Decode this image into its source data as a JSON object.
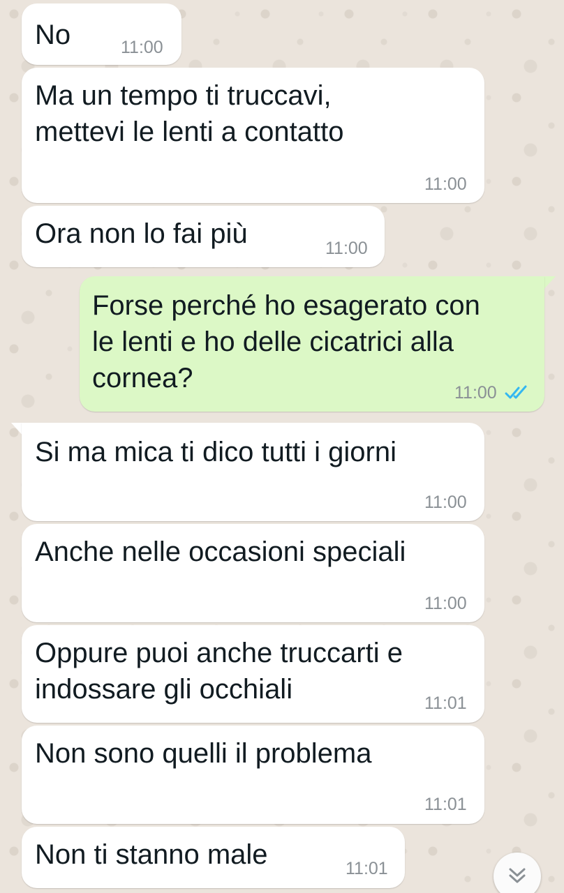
{
  "messages": [
    {
      "direction": "in",
      "text": "No",
      "time": "11:00"
    },
    {
      "direction": "in",
      "text": "Ma un tempo ti truccavi,\nmettevi le lenti a contatto",
      "time": "11:00"
    },
    {
      "direction": "in",
      "text": "Ora non lo fai più",
      "time": "11:00"
    },
    {
      "direction": "out",
      "text": "Forse perché ho esagerato con\nle lenti e ho delle cicatrici alla\ncornea?",
      "time": "11:00",
      "status_icon": "double-check-read-icon"
    },
    {
      "direction": "in",
      "text": "Si ma mica ti dico tutti i giorni",
      "time": "11:00"
    },
    {
      "direction": "in",
      "text": "Anche nelle occasioni speciali",
      "time": "11:00"
    },
    {
      "direction": "in",
      "text": "Oppure puoi anche truccarti e\nindossare gli occhiali",
      "time": "11:01"
    },
    {
      "direction": "in",
      "text": "Non sono quelli il problema",
      "time": "11:01"
    },
    {
      "direction": "in",
      "text": "Non ti stanno male",
      "time": "11:01"
    }
  ],
  "controls": {
    "scroll_down_icon": "double-chevron-down-icon"
  },
  "colors": {
    "incoming_bubble": "#ffffff",
    "outgoing_bubble": "#dcf8c6",
    "read_ticks": "#34b7f1",
    "timestamp": "#8a9095",
    "wallpaper": "#ebe4dc"
  }
}
